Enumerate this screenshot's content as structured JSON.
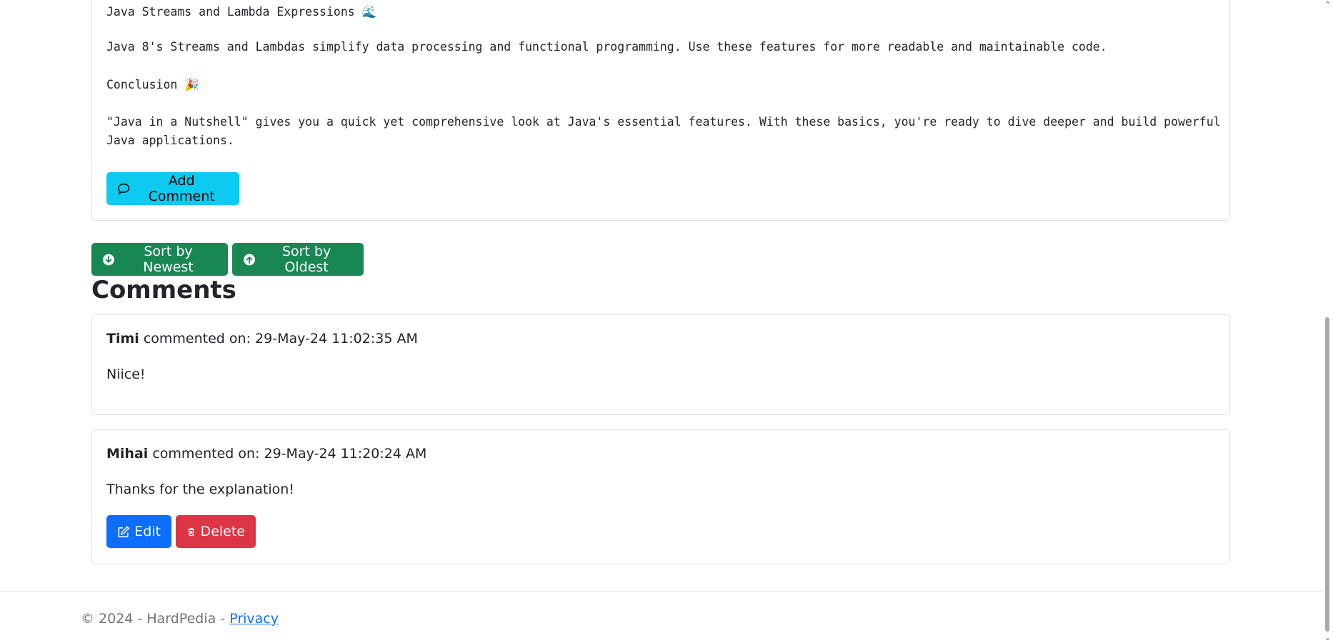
{
  "post": {
    "heading_streams": "Java Streams and Lambda Expressions",
    "heading_streams_emoji": "🌊",
    "streams_text": "Java 8's Streams and Lambdas simplify data processing and functional programming. Use these features for more readable and maintainable code.",
    "heading_conclusion": "Conclusion",
    "heading_conclusion_emoji": "🎉",
    "conclusion_text": "\"Java in a Nutshell\" gives you a quick yet comprehensive look at Java's essential features. With these basics, you're ready to dive deeper and build powerful Java applications.",
    "add_comment_label": "Add Comment"
  },
  "sort": {
    "newest_label": "Sort by Newest",
    "oldest_label": "Sort by Oldest"
  },
  "comments_title": "Comments",
  "comments": [
    {
      "author": "Timi",
      "meta_prefix": "commented on:",
      "timestamp": "29-May-24 11:02:35 AM",
      "text": "Niice!"
    },
    {
      "author": "Mihai",
      "meta_prefix": "commented on:",
      "timestamp": "29-May-24 11:20:24 AM",
      "text": "Thanks for the explanation!",
      "edit_label": "Edit",
      "delete_label": "Delete"
    }
  ],
  "footer": {
    "copyright": "© 2024 - HardPedia -",
    "privacy_label": "Privacy"
  },
  "colors": {
    "info": "#0dcaf0",
    "success": "#198754",
    "primary": "#0d6efd",
    "danger": "#dc3545"
  },
  "icons": {
    "add_comment": "chat-bubble-icon",
    "sort_newest": "arrow-down-circle-icon",
    "sort_oldest": "arrow-up-circle-icon",
    "edit": "pencil-square-icon",
    "delete": "trash-icon"
  }
}
